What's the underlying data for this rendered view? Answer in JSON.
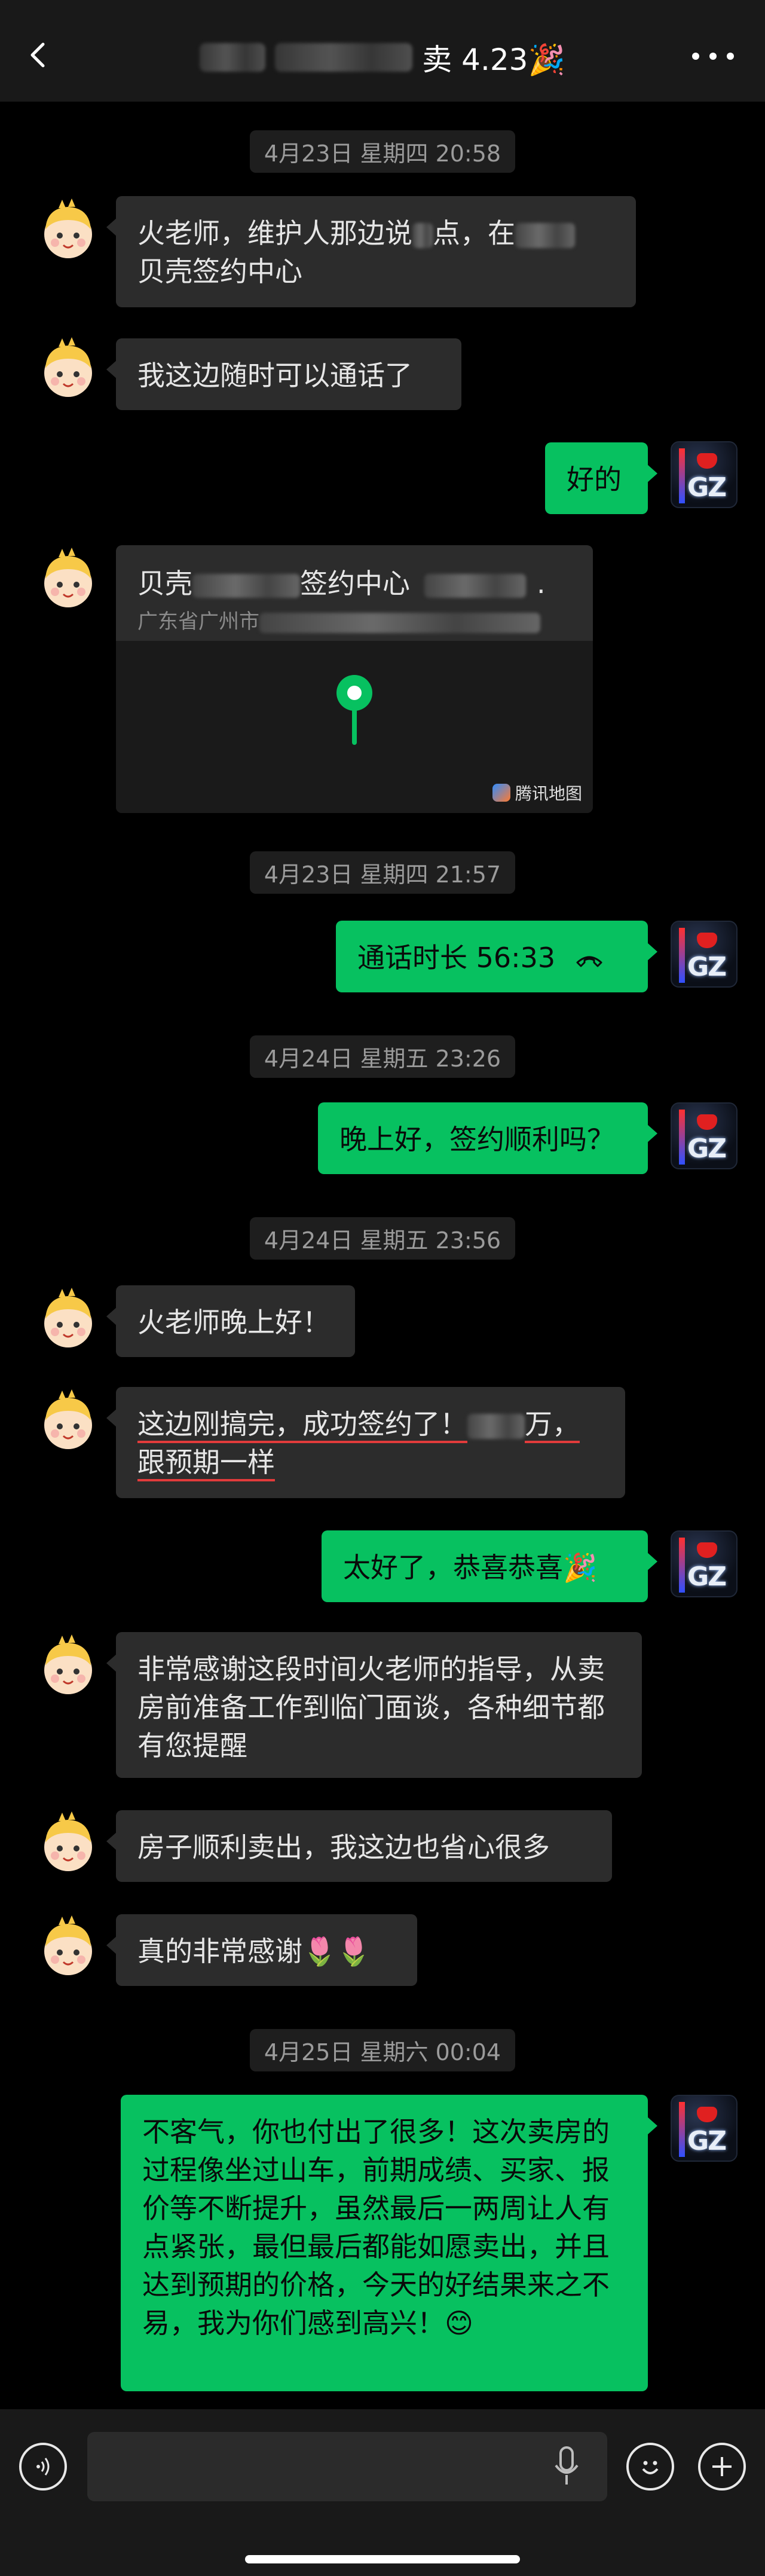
{
  "header": {
    "title_suffix": "卖 4.23",
    "title_emoji": "🎉"
  },
  "timestamps": [
    "4月23日 星期四 20:58",
    "4月23日 星期四 21:57",
    "4月24日 星期五 23:26",
    "4月24日 星期五 23:56",
    "4月25日 星期六 00:04"
  ],
  "messages": {
    "m1_a": "火老师，维护人那边说",
    "m1_b": "点，在",
    "m1_c": "贝壳签约中心",
    "m2": "我这边随时可以通话了",
    "m3": "好的",
    "location": {
      "name_prefix": "贝壳",
      "name_mid": "签约中心",
      "name_suffix": ".",
      "address_prefix": "广东省广州市",
      "brand": "腾讯地图"
    },
    "call": {
      "label": "通话时长 56:33"
    },
    "m5": "晚上好，签约顺利吗？",
    "m6": "火老师晚上好！",
    "m7_a": "这边刚搞完，成功签约了！",
    "m7_b": "万，",
    "m7_c": "跟预期一样",
    "m8": "太好了，恭喜恭喜🎉",
    "m9": "非常感谢这段时间火老师的指导，从卖房前准备工作到临门面谈，各种细节都有您提醒",
    "m10": "房子顺利卖出，我这边也省心很多",
    "m11": "真的非常感谢🌷🌷",
    "m12": "不客气，你也付出了很多！这次卖房的过程像坐过山车，前期成绩、买家、报价等不断提升，虽然最后一两周让人有点紧张，最但最后都能如愿卖出，并且达到预期的价格，今天的好结果来之不易，我为你们感到高兴！😊"
  },
  "avatars": {
    "me_text": "GZ"
  }
}
